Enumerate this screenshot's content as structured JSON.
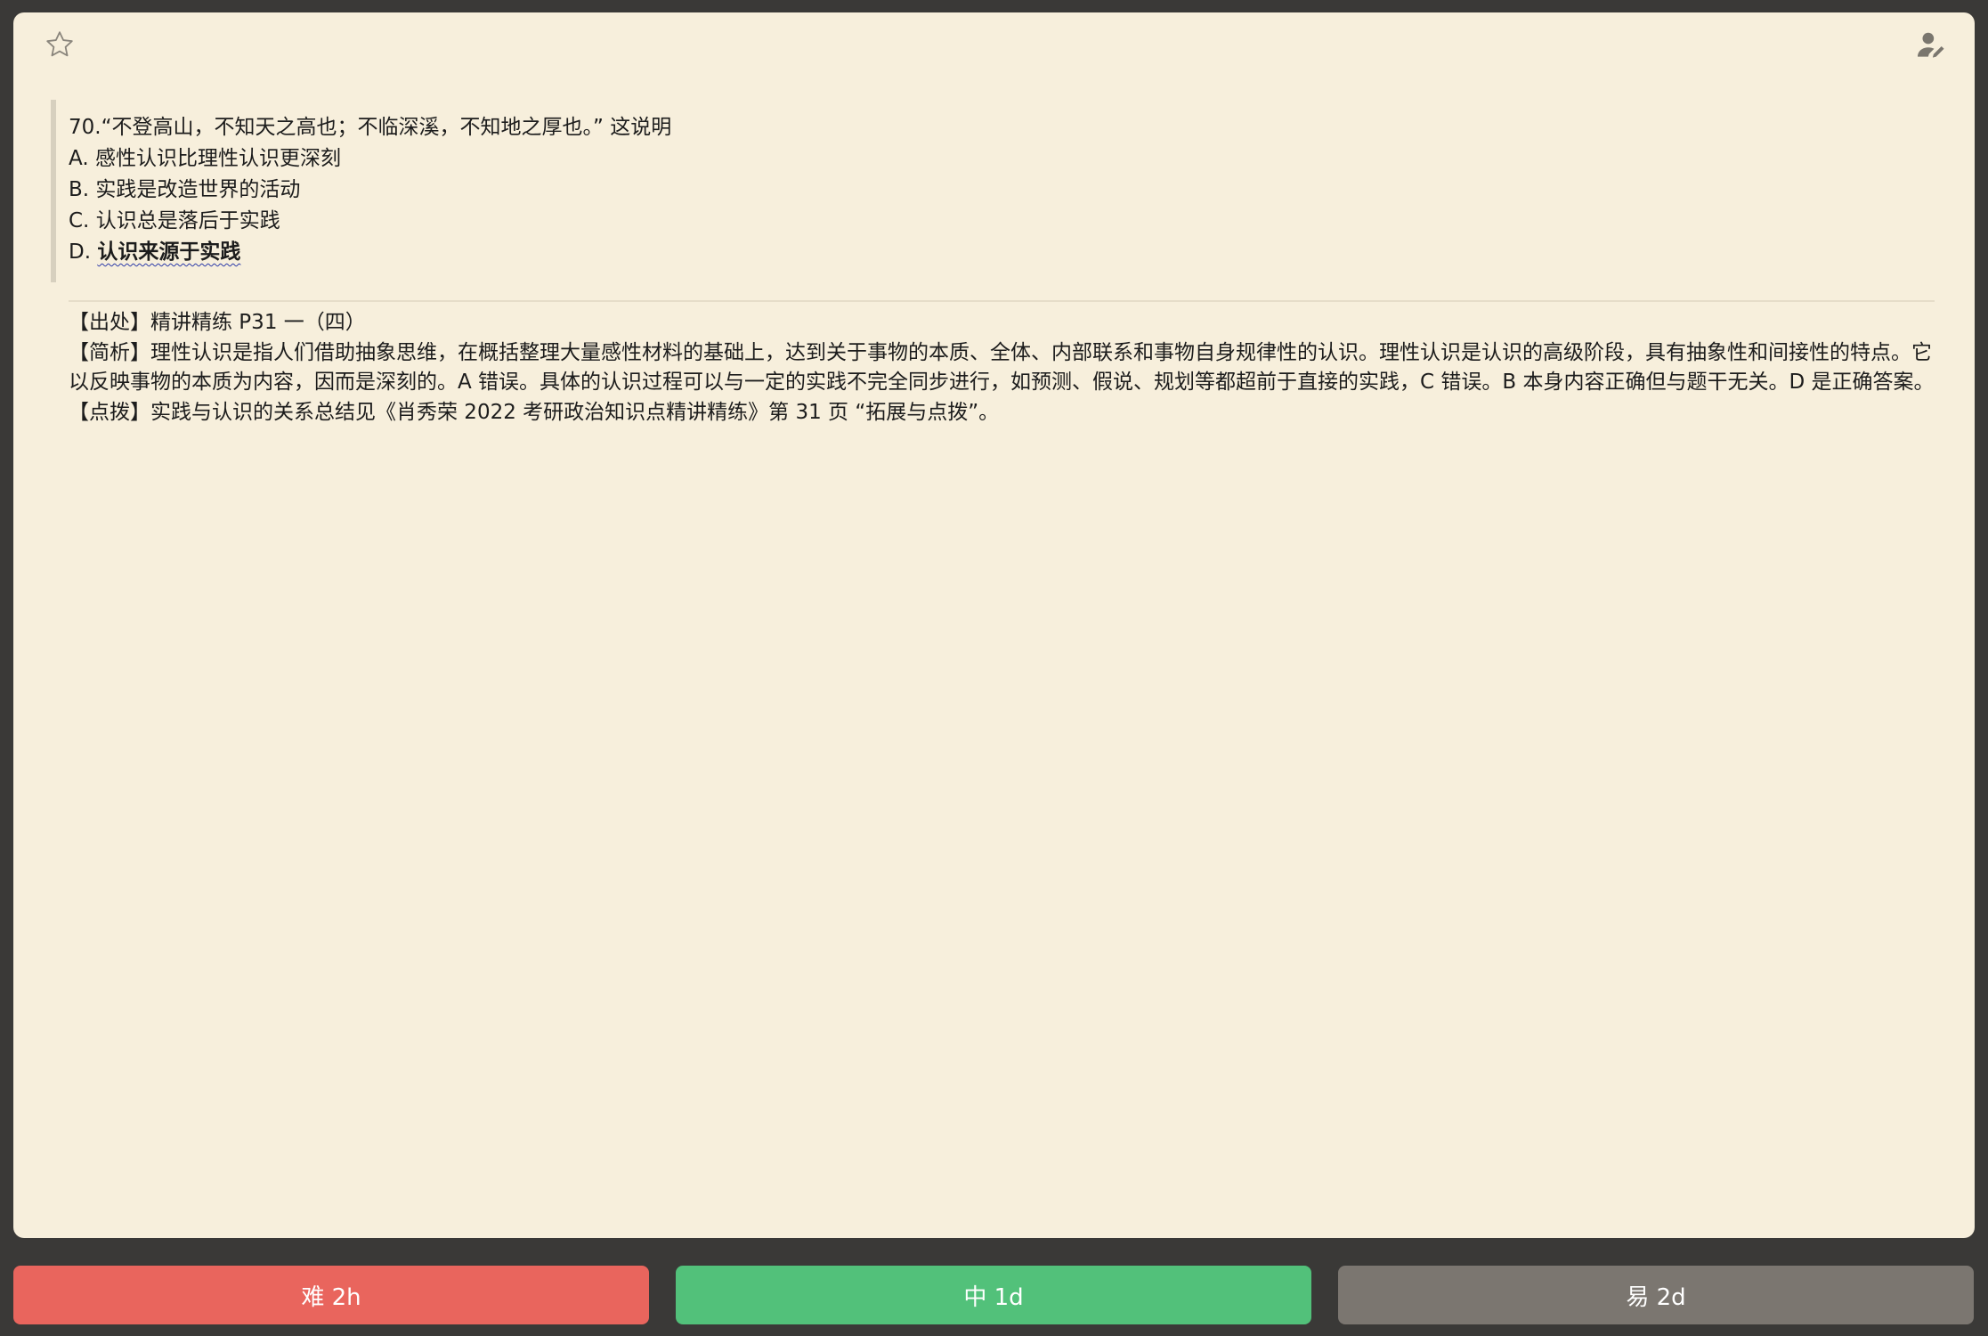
{
  "card": {
    "question": {
      "stem": "70.“不登高山，不知天之高也；不临深溪，不知地之厚也。” 这说明",
      "options": [
        {
          "prefix": "A.",
          "text": "感性认识比理性认识更深刻"
        },
        {
          "prefix": "B.",
          "text": "实践是改造世界的活动"
        },
        {
          "prefix": "C.",
          "text": "认识总是落后于实践"
        },
        {
          "prefix": "D.",
          "text": "认识来源于实践"
        }
      ]
    },
    "explanation": {
      "source": "【出处】精讲精练 P31 一（四）",
      "analysis": "【简析】理性认识是指人们借助抽象思维，在概括整理大量感性材料的基础上，达到关于事物的本质、全体、内部联系和事物自身规律性的认识。理性认识是认识的高级阶段，具有抽象性和间接性的特点。它以反映事物的本质为内容，因而是深刻的。A 错误。具体的认识过程可以与一定的实践不完全同步进行，如预测、假说、规划等都超前于直接的实践，C 错误。B 本身内容正确但与题干无关。D 是正确答案。",
      "tip": "【点拨】实践与认识的关系总结见《肖秀荣 2022 考研政治知识点精讲精练》第 31 页 “拓展与点拨”。"
    },
    "icons": {
      "top_left": "star-icon",
      "top_right": "user-edit-icon"
    }
  },
  "answer_buttons": {
    "hard": "难 2h",
    "medium": "中 1d",
    "easy": "易 2d"
  },
  "colors": {
    "card_bg": "#f7efdc",
    "app_bg": "#3a3937",
    "hard": "#e9655d",
    "medium": "#52c17a",
    "easy": "#7b7670"
  }
}
